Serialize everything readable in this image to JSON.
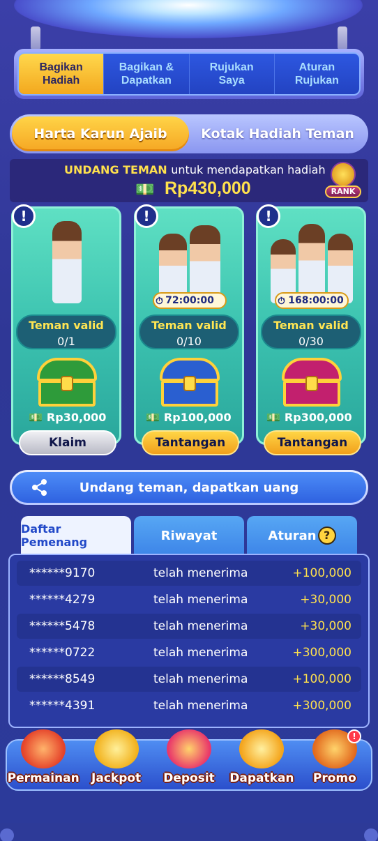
{
  "top_tabs": [
    {
      "label": "Bagikan\nHadiah",
      "active": true
    },
    {
      "label": "Bagikan &\nDapatkan",
      "active": false
    },
    {
      "label": "Rujukan\nSaya",
      "active": false
    },
    {
      "label": "Aturan\nRujukan",
      "active": false
    }
  ],
  "segment": {
    "left": "Harta Karun Ajaib",
    "right": "Kotak Hadiah Teman",
    "selected": "left"
  },
  "invite": {
    "highlight": "UNDANG TEMAN",
    "text": "untuk mendapatkan hadiah",
    "amount": "Rp430,000",
    "rank_label": "RANK"
  },
  "cards": [
    {
      "timer": "",
      "valid_label": "Teman valid",
      "valid_count": "0/1",
      "prize": "Rp30,000",
      "button": "Klaim",
      "button_style": "gray",
      "chest_color": "#2e9b3a"
    },
    {
      "timer": "72:00:00",
      "valid_label": "Teman valid",
      "valid_count": "0/10",
      "prize": "Rp100,000",
      "button": "Tantangan",
      "button_style": "gold",
      "chest_color": "#2a5fd0"
    },
    {
      "timer": "168:00:00",
      "valid_label": "Teman valid",
      "valid_count": "0/30",
      "prize": "Rp300,000",
      "button": "Tantangan",
      "button_style": "gold",
      "chest_color": "#c2206e"
    }
  ],
  "share_button": "Undang teman, dapatkan uang",
  "list_tabs": [
    {
      "label": "Daftar Pemenang",
      "active": true
    },
    {
      "label": "Riwayat",
      "active": false
    },
    {
      "label": "Aturan",
      "active": false
    }
  ],
  "winners": [
    {
      "user": "******9170",
      "status": "telah menerima",
      "amount": "+100,000"
    },
    {
      "user": "******4279",
      "status": "telah menerima",
      "amount": "+30,000"
    },
    {
      "user": "******5478",
      "status": "telah menerima",
      "amount": "+30,000"
    },
    {
      "user": "******0722",
      "status": "telah menerima",
      "amount": "+300,000"
    },
    {
      "user": "******8549",
      "status": "telah menerima",
      "amount": "+100,000"
    },
    {
      "user": "******4391",
      "status": "telah menerima",
      "amount": "+300,000"
    }
  ],
  "bottom_nav": [
    {
      "label": "Permainan",
      "icon": "slot-machine-icon",
      "color": "#e5432a"
    },
    {
      "label": "Jackpot",
      "icon": "trophy-icon",
      "color": "#f2b21e"
    },
    {
      "label": "Deposit",
      "icon": "gift-box-icon",
      "color": "#e9386a"
    },
    {
      "label": "Dapatkan",
      "icon": "handshake-coin-icon",
      "color": "#f4a51c"
    },
    {
      "label": "Promo",
      "icon": "treasure-chest-icon",
      "color": "#e26a1e"
    }
  ],
  "promo_badge": "!",
  "colors": {
    "gold": "#ffd84d",
    "accent_blue": "#2d57e0",
    "teal": "#3cc3b0"
  }
}
